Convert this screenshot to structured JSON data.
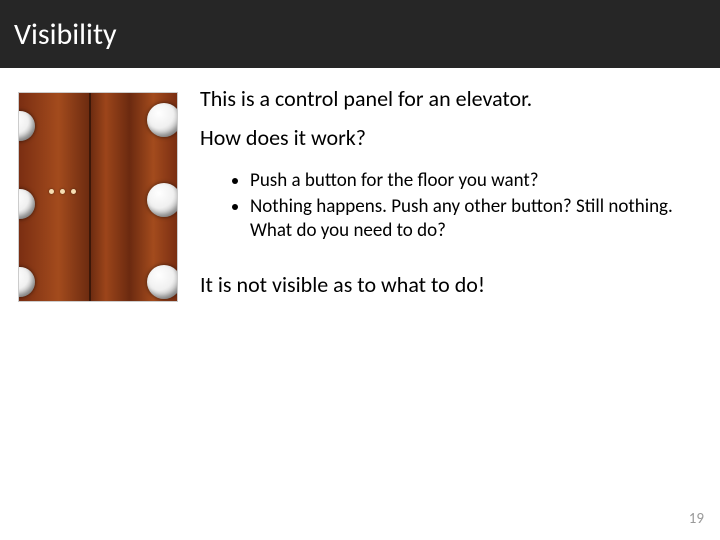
{
  "title": "Visibility",
  "intro": "This is a control panel for an elevator.",
  "question": "How does it work?",
  "bullets": [
    "Push a button for the floor you want?",
    "Nothing happens. Push any other button? Still nothing. What do you need to do?"
  ],
  "closing": "It is not visible as to what to do!",
  "page_number": "19",
  "image_alt": "elevator-control-panel"
}
